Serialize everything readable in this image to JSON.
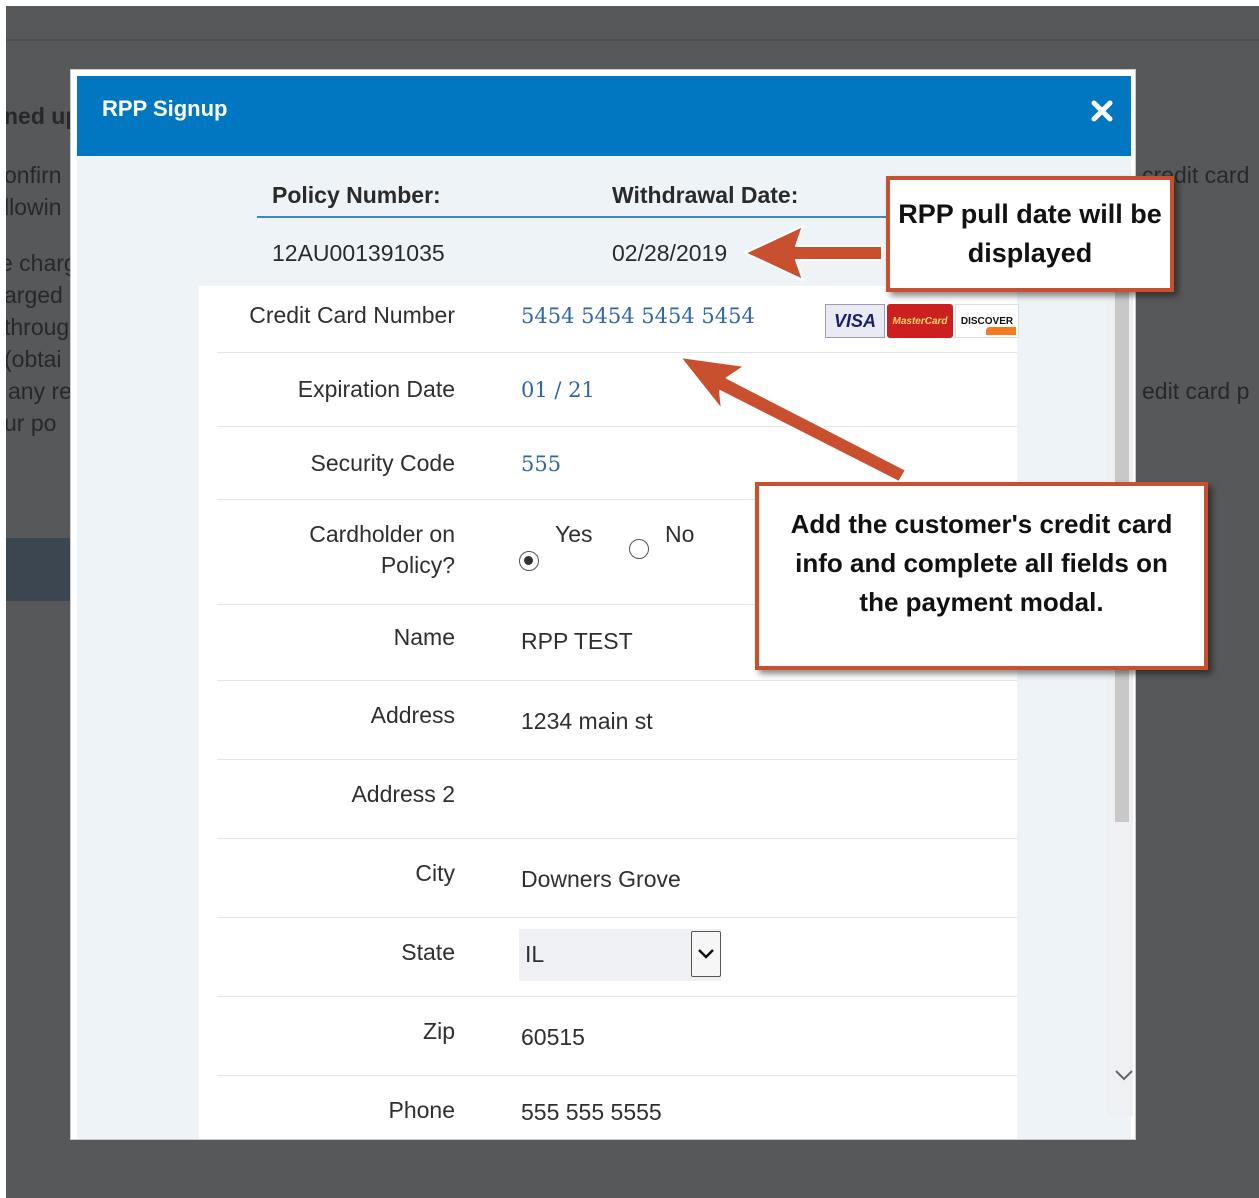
{
  "background": {
    "fragments": [
      "ned up",
      "onfirn",
      "llowin",
      "e charg",
      "arged",
      "throug",
      "(obtai",
      "any re",
      "ur po",
      "credit card",
      "edit card p"
    ]
  },
  "modal": {
    "title": "RPP Signup",
    "close_icon": "close-icon",
    "policy": {
      "policy_label": "Policy Number:",
      "policy_value": "12AU001391035",
      "withdrawal_label": "Withdrawal Date:",
      "withdrawal_value": "02/28/2019"
    },
    "form": {
      "credit_card_label": "Credit Card Number",
      "credit_card_value": "5454 5454 5454 5454",
      "card_brands": [
        "VISA",
        "MasterCard",
        "DISCOVER"
      ],
      "expiration_label": "Expiration Date",
      "expiration_value": "01 / 21",
      "security_label": "Security Code",
      "security_value": "555",
      "cardholder_label_line1": "Cardholder on",
      "cardholder_label_line2": "Policy?",
      "yes_label": "Yes",
      "no_label": "No",
      "cardholder_selected": "Yes",
      "name_label": "Name",
      "name_value": "RPP TEST",
      "address_label": "Address",
      "address_value": "1234 main st",
      "address2_label": "Address 2",
      "address2_value": "",
      "city_label": "City",
      "city_value": "Downers Grove",
      "state_label": "State",
      "state_value": "IL",
      "zip_label": "Zip",
      "zip_value": "60515",
      "phone_label": "Phone",
      "phone_value": "555 555 5555"
    }
  },
  "annotations": {
    "callout_1": "RPP pull date will be displayed",
    "callout_2": "Add the customer's credit card info and complete all fields on the payment modal.",
    "accent_color": "#c8502f"
  },
  "colors": {
    "header_blue": "#0077c0",
    "backdrop": "#575859"
  }
}
